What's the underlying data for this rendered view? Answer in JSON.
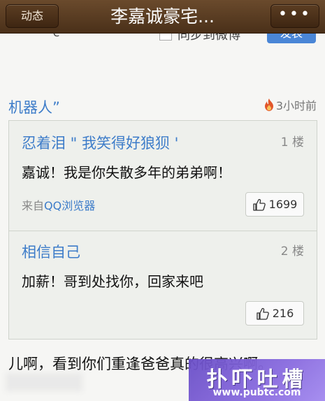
{
  "header": {
    "back_label": "动态",
    "title": "李嘉诚豪宅...",
    "more_label": "•••"
  },
  "cut_row": {
    "left_text": "’’c",
    "text": "同步到微博",
    "button": "发表"
  },
  "post": {
    "author": "机器人”",
    "time": "3小时前"
  },
  "comments": [
    {
      "name": "忍着泪 \" 我笑得好狼狈 '",
      "floor": "1 楼",
      "text": "嘉诚！我是你失散多年的弟弟啊！",
      "source_prefix": "来自",
      "source_app": "QQ浏览器",
      "likes": "1699"
    },
    {
      "name": "相信自己",
      "floor": "2 楼",
      "text": "加薪！哥到处找你，回家来吧",
      "likes": "216"
    }
  ],
  "bottom_text": "儿啊，看到你们重逢爸爸真的很高兴啊。",
  "watermark": {
    "main": "扑吓吐槽",
    "url": "www.pubtc.com"
  },
  "colors": {
    "header_bg": "#5a3b20",
    "link": "#3d7cc9",
    "fire": "#e2572b"
  }
}
